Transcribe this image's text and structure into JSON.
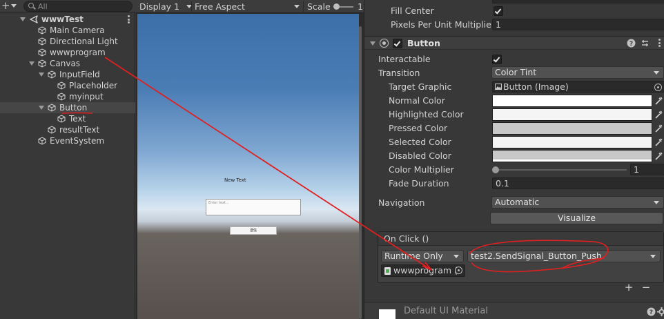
{
  "hierarchy": {
    "search_placeholder": "All",
    "scene_name": "wwwTest",
    "items": [
      {
        "label": "Main Camera"
      },
      {
        "label": "Directional Light"
      },
      {
        "label": "wwwprogram"
      },
      {
        "label": "Canvas"
      },
      {
        "label": "InputField"
      },
      {
        "label": "Placeholder"
      },
      {
        "label": "myinput"
      },
      {
        "label": "Button"
      },
      {
        "label": "Text"
      },
      {
        "label": "resultText"
      },
      {
        "label": "EventSystem"
      }
    ]
  },
  "game_view": {
    "display": "Display 1",
    "aspect": "Free Aspect",
    "scale_label": "Scale",
    "scale_value": "1",
    "ui_text": "New Text",
    "ui_input_placeholder": "Enter text...",
    "ui_button_label": "送信"
  },
  "inspector": {
    "fill_center_label": "Fill Center",
    "fill_center_checked": true,
    "ppu_label": "Pixels Per Unit Multiplier",
    "ppu_value": "1",
    "component_title": "Button",
    "component_enabled": true,
    "interactable_label": "Interactable",
    "interactable_checked": true,
    "transition_label": "Transition",
    "transition_value": "Color Tint",
    "target_graphic_label": "Target Graphic",
    "target_graphic_value": "Button (Image)",
    "colors": [
      {
        "label": "Normal Color",
        "value": "#FFFFFF"
      },
      {
        "label": "Highlighted Color",
        "value": "#F5F5F5"
      },
      {
        "label": "Pressed Color",
        "value": "#C8C8C8"
      },
      {
        "label": "Selected Color",
        "value": "#F5F5F5"
      },
      {
        "label": "Disabled Color",
        "value": "#C8C8C8"
      }
    ],
    "color_multiplier_label": "Color Multiplier",
    "color_multiplier_value": "1",
    "fade_duration_label": "Fade Duration",
    "fade_duration_value": "0.1",
    "navigation_label": "Navigation",
    "navigation_value": "Automatic",
    "visualize_label": "Visualize",
    "onclick_title": "On Click ()",
    "runtime_value": "Runtime Only",
    "function_value": "test2.SendSignal_Button_Push",
    "object_value": "wwwprogram (t",
    "add_label": "+",
    "remove_label": "−",
    "material_title": "Default UI Material"
  },
  "annotation_color": "#e02020"
}
